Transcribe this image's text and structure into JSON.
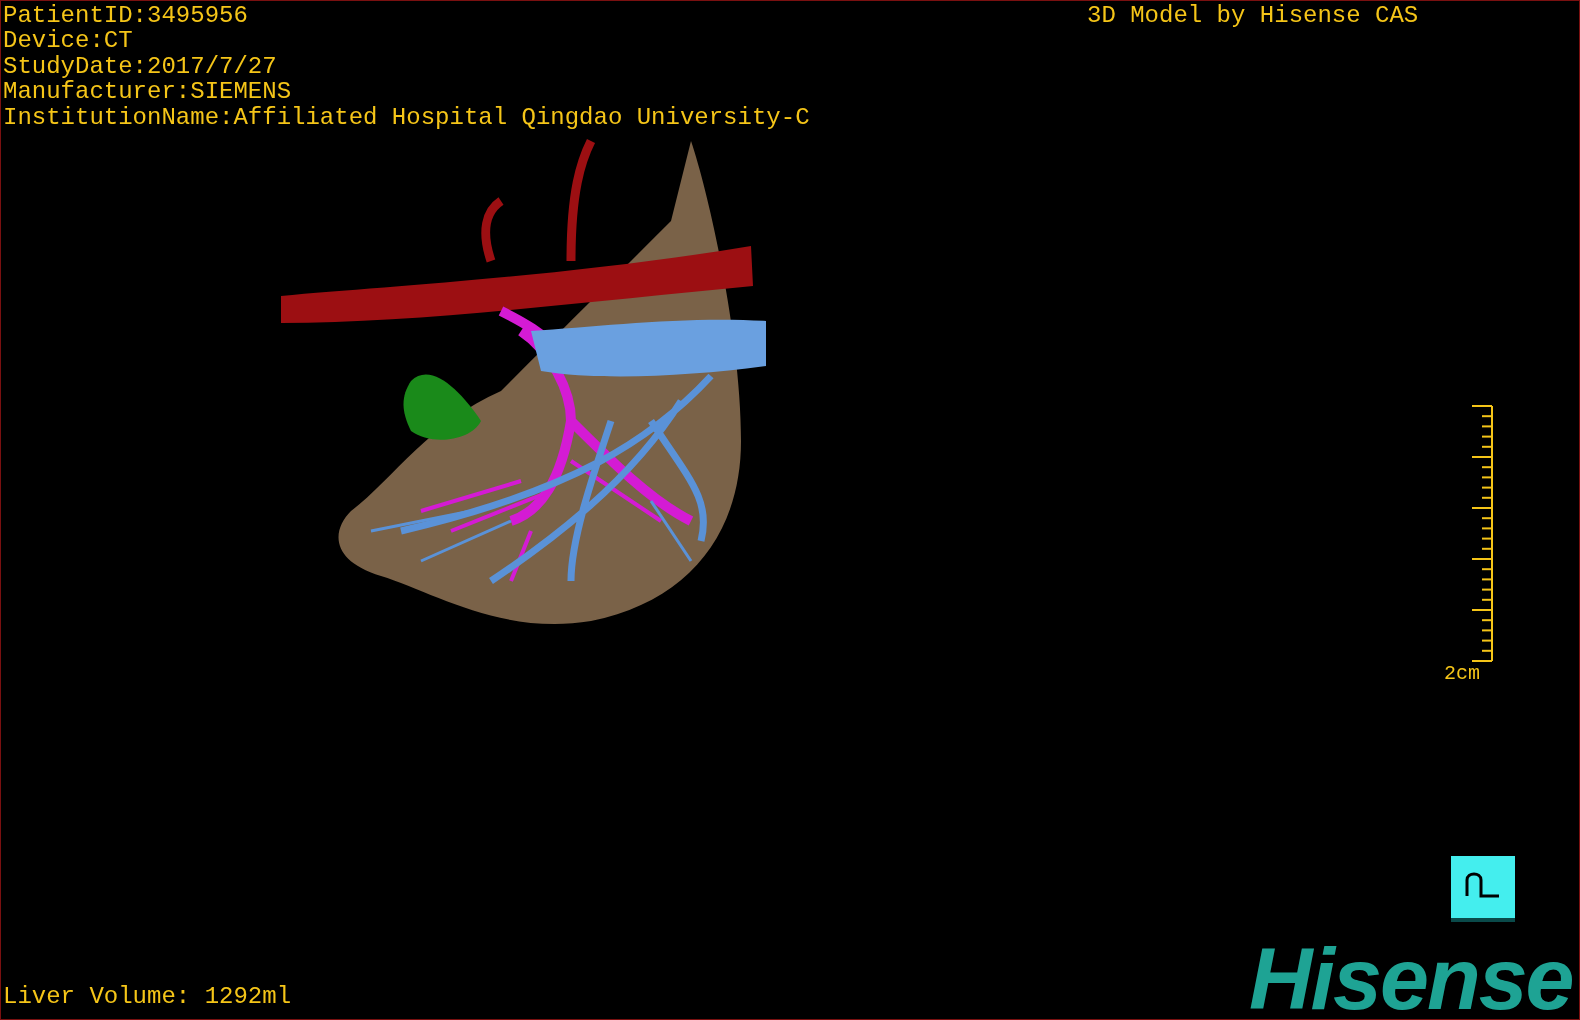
{
  "patient_info": [
    "PatientID:3495956",
    "Device:CT",
    "StudyDate:2017/7/27",
    "Manufacturer:SIEMENS",
    "InstitutionName:Affiliated Hospital Qingdao University-C"
  ],
  "model_credit": "3D Model by Hisense CAS",
  "scale_bar": {
    "label": "2cm"
  },
  "liver_volume": "Liver Volume: 1292ml",
  "logo": "Hisense"
}
